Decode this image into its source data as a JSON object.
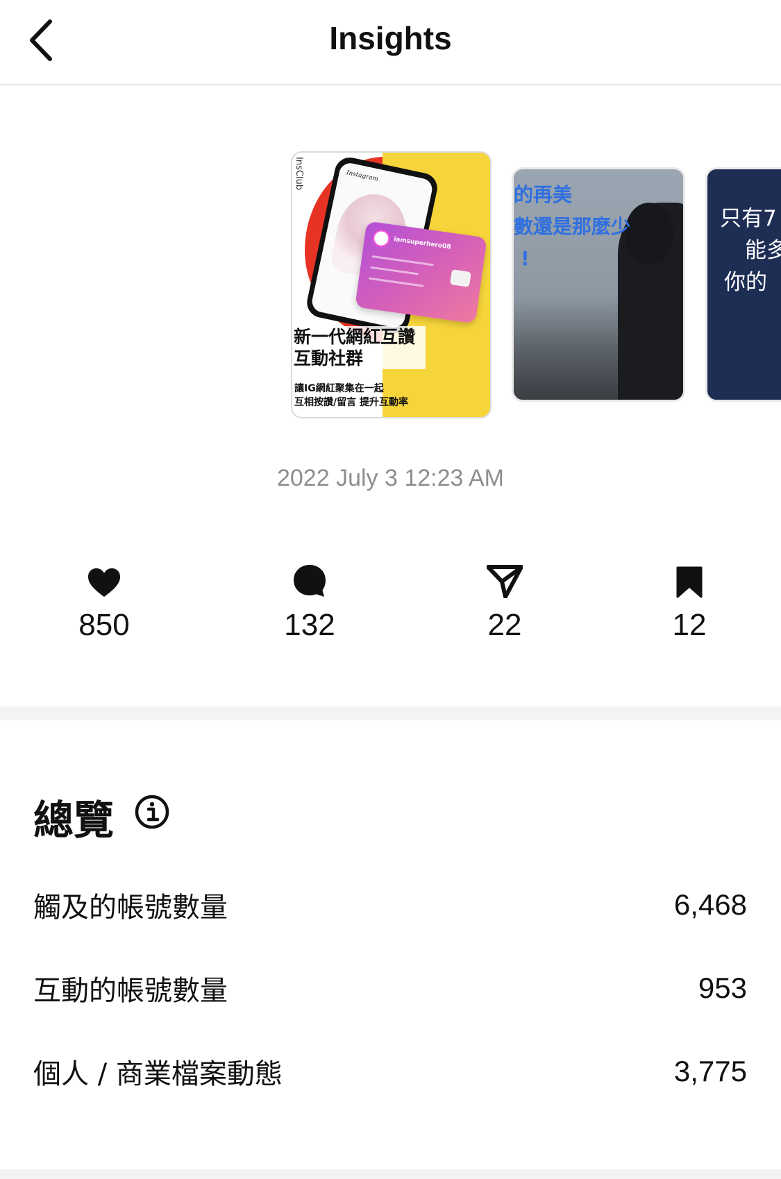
{
  "header": {
    "title": "Insights",
    "back_icon": "chevron-left-icon"
  },
  "carousel": {
    "active_post": {
      "side_text": "InsClub",
      "app_name": "Instagram",
      "card_name": "iamsuperhero08",
      "title_line1": "新一代網紅互讚",
      "title_line2": "互動社群",
      "sub_line1": "讓IG網紅聚集在一起",
      "sub_line2": "互相按讚/留言 提升互動率"
    },
    "post_2": {
      "line1": "的再美",
      "line2": "數還是那麼少",
      "line3": "!"
    },
    "post_3": {
      "line1": "只有7",
      "line2": "能多",
      "line3": "你的"
    }
  },
  "timestamp": "2022 July 3 12:23 AM",
  "stats": {
    "likes": {
      "icon": "heart-icon",
      "value": "850"
    },
    "comments": {
      "icon": "comment-icon",
      "value": "132"
    },
    "shares": {
      "icon": "send-icon",
      "value": "22"
    },
    "saves": {
      "icon": "bookmark-icon",
      "value": "12"
    }
  },
  "overview": {
    "title": "總覽",
    "info_icon": "info-icon",
    "rows": [
      {
        "label": "觸及的帳號數量",
        "value": "6,468"
      },
      {
        "label": "互動的帳號數量",
        "value": "953"
      },
      {
        "label": "個人 / 商業檔案動態",
        "value": "3,775"
      }
    ]
  },
  "colors": {
    "text": "#111111",
    "muted": "#8e8e8e",
    "divider": "#f3f3f3",
    "post3_bg": "#1d2d54",
    "post2_text": "#2f6fe0"
  }
}
